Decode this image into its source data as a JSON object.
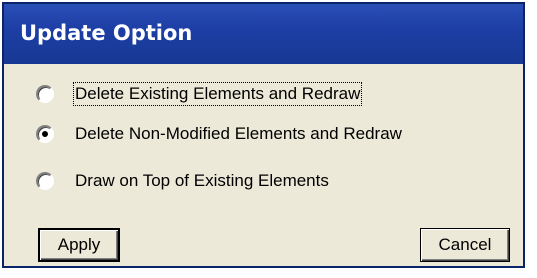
{
  "dialog": {
    "title": "Update Option"
  },
  "options": [
    {
      "label": "Delete Existing Elements and Redraw",
      "selected": false,
      "focused": true
    },
    {
      "label": "Delete Non-Modified Elements and Redraw",
      "selected": true,
      "focused": false
    },
    {
      "label": "Draw on Top of Existing Elements",
      "selected": false,
      "focused": false
    }
  ],
  "buttons": {
    "apply_label": "Apply",
    "cancel_label": "Cancel"
  }
}
